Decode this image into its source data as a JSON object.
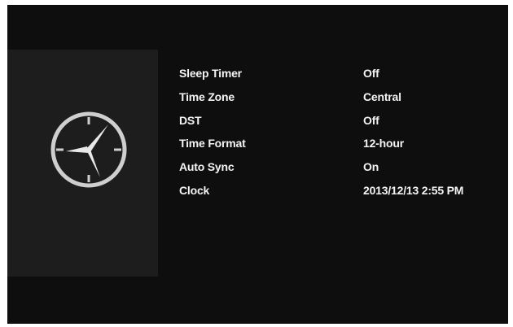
{
  "icon": "clock-icon",
  "settings": {
    "rows": [
      {
        "label": "Sleep Timer",
        "value": "Off"
      },
      {
        "label": "Time Zone",
        "value": "Central"
      },
      {
        "label": "DST",
        "value": "Off"
      },
      {
        "label": "Time Format",
        "value": "12-hour"
      },
      {
        "label": "Auto Sync",
        "value": "On"
      },
      {
        "label": "Clock",
        "value": "2013/12/13 2:55 PM"
      }
    ]
  },
  "colors": {
    "background": "#0e0e0e",
    "panel": "#1d1d1d",
    "text": "#f4f4f4"
  }
}
